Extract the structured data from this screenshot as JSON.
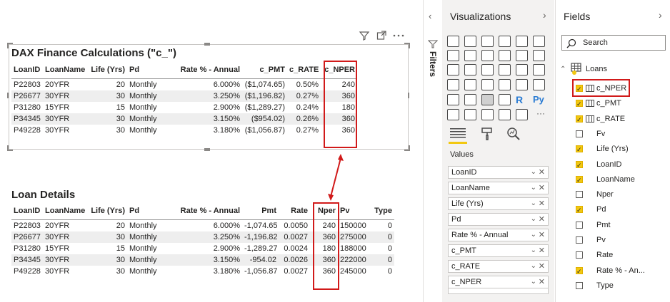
{
  "canvas": {
    "table1": {
      "title": "DAX Finance Calculations (\"c_\")",
      "columns": [
        "LoanID",
        "LoanName",
        "Life (Yrs)",
        "Pd",
        "Rate % - Annual",
        "c_PMT",
        "c_RATE",
        "c_NPER"
      ],
      "rows": [
        [
          "P22803",
          "20YFR",
          "20",
          "Monthly",
          "6.000%",
          "($1,074.65)",
          "0.50%",
          "240"
        ],
        [
          "P26677",
          "30YFR",
          "30",
          "Monthly",
          "3.250%",
          "($1,196.82)",
          "0.27%",
          "360"
        ],
        [
          "P31280",
          "15YFR",
          "15",
          "Monthly",
          "2.900%",
          "($1,289.27)",
          "0.24%",
          "180"
        ],
        [
          "P34345",
          "30YFR",
          "30",
          "Monthly",
          "3.150%",
          "($954.02)",
          "0.26%",
          "360"
        ],
        [
          "P49228",
          "30YFR",
          "30",
          "Monthly",
          "3.180%",
          "($1,056.87)",
          "0.27%",
          "360"
        ]
      ]
    },
    "table2": {
      "title": "Loan Details",
      "columns": [
        "LoanID",
        "LoanName",
        "Life (Yrs)",
        "Pd",
        "Rate % - Annual",
        "Pmt",
        "Rate",
        "Nper",
        "Pv",
        "Type"
      ],
      "rows": [
        [
          "P22803",
          "20YFR",
          "20",
          "Monthly",
          "6.000%",
          "-1,074.65",
          "0.0050",
          "240",
          "150000",
          "0"
        ],
        [
          "P26677",
          "30YFR",
          "30",
          "Monthly",
          "3.250%",
          "-1,196.82",
          "0.0027",
          "360",
          "275000",
          "0"
        ],
        [
          "P31280",
          "15YFR",
          "15",
          "Monthly",
          "2.900%",
          "-1,289.27",
          "0.0024",
          "180",
          "188000",
          "0"
        ],
        [
          "P34345",
          "30YFR",
          "30",
          "Monthly",
          "3.150%",
          "-954.02",
          "0.0026",
          "360",
          "222000",
          "0"
        ],
        [
          "P49228",
          "30YFR",
          "30",
          "Monthly",
          "3.180%",
          "-1,056.87",
          "0.0027",
          "360",
          "245000",
          "0"
        ]
      ]
    },
    "highlight_color": "#d11a1a"
  },
  "filters": {
    "label": "Filters"
  },
  "visualizations": {
    "title": "Visualizations",
    "values_label": "Values",
    "wells": [
      "LoanID",
      "LoanName",
      "Life (Yrs)",
      "Pd",
      "Rate % - Annual",
      "c_PMT",
      "c_RATE",
      "c_NPER"
    ],
    "glyph_r": "R",
    "glyph_py": "Py",
    "more": "···"
  },
  "fields": {
    "title": "Fields",
    "search_placeholder": "Search",
    "table_name": "Loans",
    "items": [
      {
        "name": "c_NPER",
        "checked": true,
        "calc": true
      },
      {
        "name": "c_PMT",
        "checked": true,
        "calc": true
      },
      {
        "name": "c_RATE",
        "checked": true,
        "calc": true
      },
      {
        "name": "Fv",
        "checked": false,
        "calc": false
      },
      {
        "name": "Life (Yrs)",
        "checked": true,
        "calc": false
      },
      {
        "name": "LoanID",
        "checked": true,
        "calc": false
      },
      {
        "name": "LoanName",
        "checked": true,
        "calc": false
      },
      {
        "name": "Nper",
        "checked": false,
        "calc": false
      },
      {
        "name": "Pd",
        "checked": true,
        "calc": false
      },
      {
        "name": "Pmt",
        "checked": false,
        "calc": false
      },
      {
        "name": "Pv",
        "checked": false,
        "calc": false
      },
      {
        "name": "Rate",
        "checked": false,
        "calc": false
      },
      {
        "name": "Rate % - An...",
        "checked": true,
        "calc": false
      },
      {
        "name": "Type",
        "checked": false,
        "calc": false
      }
    ],
    "accent_color": "#f2c811"
  }
}
